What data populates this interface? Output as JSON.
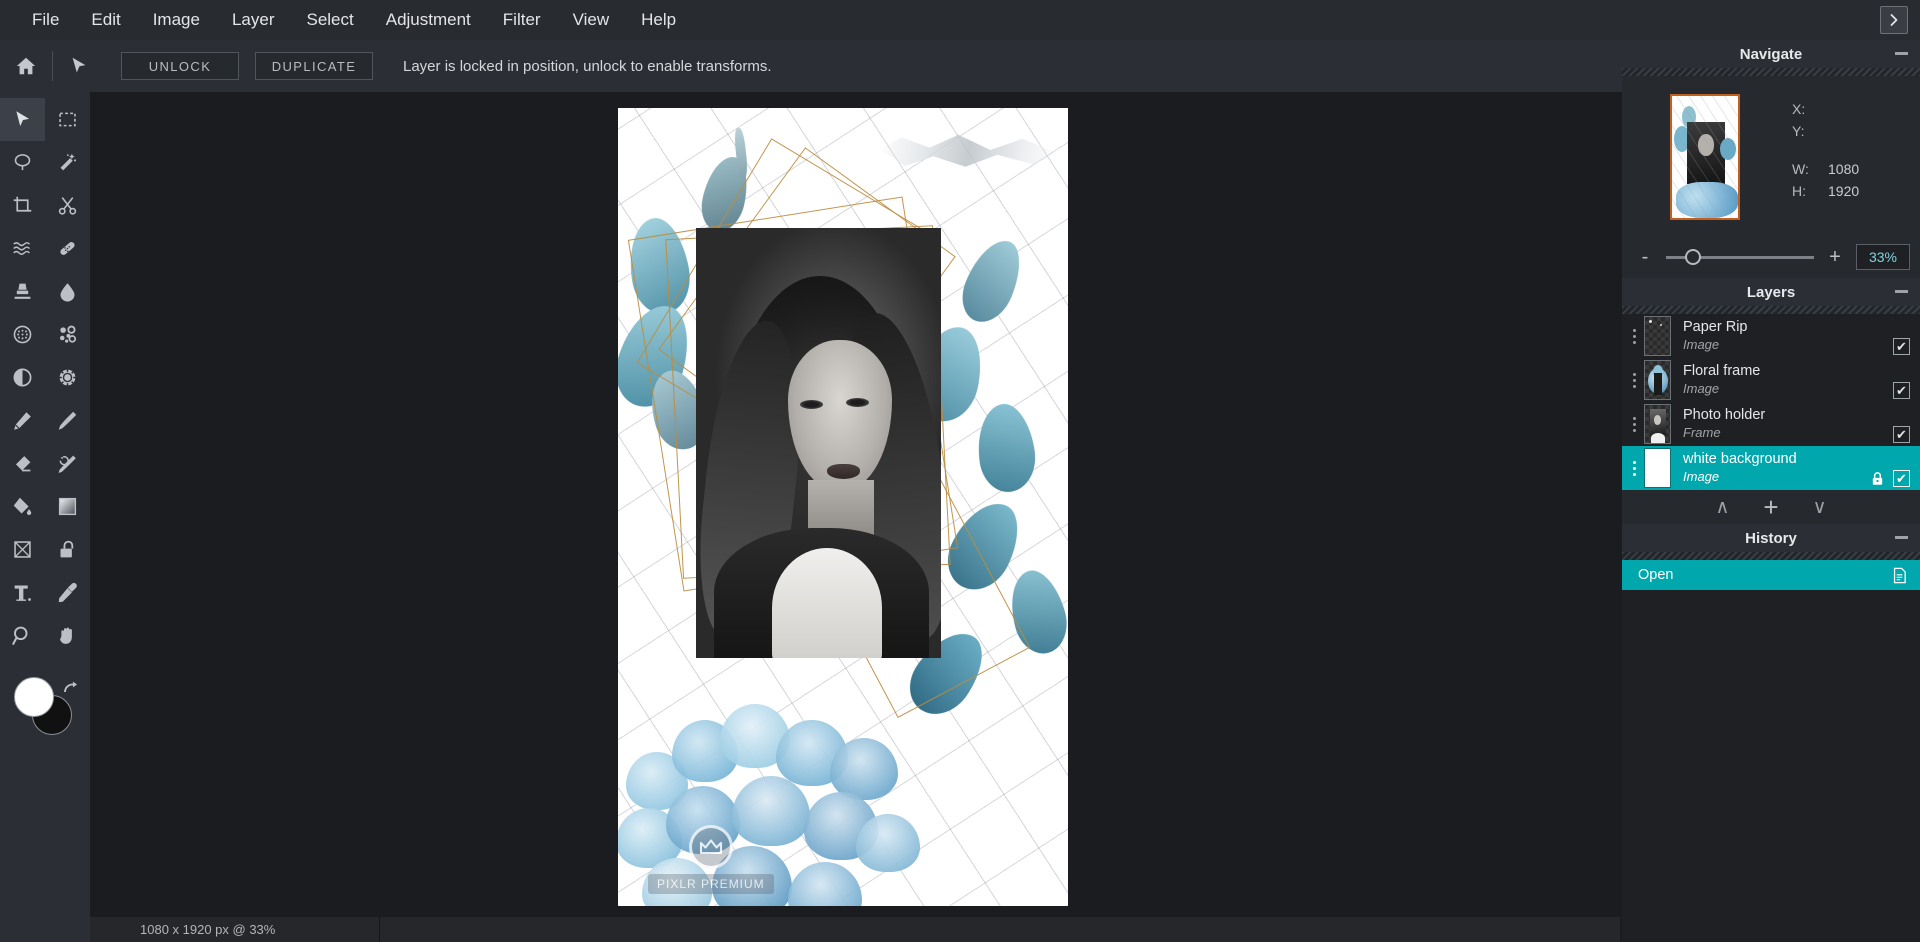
{
  "menubar": {
    "items": [
      {
        "label": "File"
      },
      {
        "label": "Edit"
      },
      {
        "label": "Image"
      },
      {
        "label": "Layer"
      },
      {
        "label": "Select"
      },
      {
        "label": "Adjustment"
      },
      {
        "label": "Filter"
      },
      {
        "label": "View"
      },
      {
        "label": "Help"
      }
    ],
    "expand_icon": "chevron-right-icon"
  },
  "optionsbar": {
    "home_icon": "home-icon",
    "active_tool_icon": "arrow-select-icon",
    "unlock_label": "UNLOCK",
    "duplicate_label": "DUPLICATE",
    "hint": "Layer is locked in position, unlock to enable transforms."
  },
  "toolbar": {
    "tools": [
      {
        "name": "arrange-select-tool",
        "icon": "cursor-arrow-icon",
        "active": true
      },
      {
        "name": "marquee-select-tool",
        "icon": "dashed-rectangle-icon",
        "active": false
      },
      {
        "name": "lasso-select-tool",
        "icon": "lasso-icon",
        "active": false
      },
      {
        "name": "magic-wand-tool",
        "icon": "magic-wand-icon",
        "active": false
      },
      {
        "name": "crop-tool",
        "icon": "crop-icon",
        "active": false
      },
      {
        "name": "cutout-tool",
        "icon": "scissors-icon",
        "active": false
      },
      {
        "name": "liquify-tool",
        "icon": "wave-lines-icon",
        "active": false
      },
      {
        "name": "heal-tool",
        "icon": "bandage-icon",
        "active": false
      },
      {
        "name": "clone-stamp-tool",
        "icon": "stamp-icon",
        "active": false
      },
      {
        "name": "blur-tool",
        "icon": "water-drop-icon",
        "active": false
      },
      {
        "name": "detail-tool",
        "icon": "dotted-circle-icon",
        "active": false
      },
      {
        "name": "dodge-burn-tool",
        "icon": "bubbles-icon",
        "active": false
      },
      {
        "name": "contrast-tool",
        "icon": "half-circle-icon",
        "active": false
      },
      {
        "name": "effects-tool",
        "icon": "sun-gear-icon",
        "active": false
      },
      {
        "name": "pen-tool",
        "icon": "pen-icon",
        "active": false
      },
      {
        "name": "paint-brush-tool",
        "icon": "paint-brush-icon",
        "active": false
      },
      {
        "name": "eraser-tool",
        "icon": "eraser-icon",
        "active": false
      },
      {
        "name": "retouch-brush-tool",
        "icon": "brush-swirl-icon",
        "active": false
      },
      {
        "name": "paint-bucket-tool",
        "icon": "paint-bucket-icon",
        "active": false
      },
      {
        "name": "gradient-tool",
        "icon": "gradient-square-icon",
        "active": false
      },
      {
        "name": "shape-tool",
        "icon": "crossed-box-icon",
        "active": false
      },
      {
        "name": "lock-shape-tool",
        "icon": "padlock-icon",
        "active": false
      },
      {
        "name": "text-tool",
        "icon": "text-t-icon",
        "active": false
      },
      {
        "name": "color-picker-tool",
        "icon": "eyedropper-icon",
        "active": false
      },
      {
        "name": "zoom-tool",
        "icon": "magnifier-icon",
        "active": false
      },
      {
        "name": "hand-tool",
        "icon": "hand-icon",
        "active": false
      }
    ],
    "foreground_color": "#ffffff",
    "background_color": "#111111",
    "swap_icon": "swap-colors-icon"
  },
  "canvas": {
    "watermark_text": "PIXLR PREMIUM",
    "watermark_icon": "crown-icon"
  },
  "statusbar": {
    "zoom_info": "1080 x 1920 px @ 33%"
  },
  "navigate": {
    "title": "Navigate",
    "minimize_icon": "minimize-icon",
    "thumbnail_name": "navigate-thumbnail",
    "fields": [
      {
        "label": "X:",
        "value": ""
      },
      {
        "label": "Y:",
        "value": ""
      },
      {
        "label": "W:",
        "value": "1080"
      },
      {
        "label": "H:",
        "value": "1920"
      }
    ],
    "zoom_minus": "-",
    "zoom_plus": "+",
    "zoom_value": "33%",
    "zoom_slider_percent": 13
  },
  "layers": {
    "title": "Layers",
    "minimize_icon": "minimize-icon",
    "items": [
      {
        "name": "Paper Rip",
        "kind": "Image",
        "visible": true,
        "locked": false,
        "selected": false,
        "thumb": "transparent"
      },
      {
        "name": "Floral frame",
        "kind": "Image",
        "visible": true,
        "locked": false,
        "selected": false,
        "thumb": "floral"
      },
      {
        "name": "Photo holder",
        "kind": "Frame",
        "visible": true,
        "locked": false,
        "selected": false,
        "thumb": "photo"
      },
      {
        "name": "white background",
        "kind": "Image",
        "visible": true,
        "locked": true,
        "selected": true,
        "thumb": "white"
      }
    ],
    "actions": [
      {
        "name": "move-layer-up-button",
        "icon": "chevron-up-icon",
        "glyph": "∧"
      },
      {
        "name": "add-layer-button",
        "icon": "plus-icon",
        "glyph": "+"
      },
      {
        "name": "move-layer-down-button",
        "icon": "chevron-down-icon",
        "glyph": "∨"
      }
    ],
    "check_glyph": "✔",
    "lock_icon": "padlock-icon"
  },
  "history": {
    "title": "History",
    "minimize_icon": "minimize-icon",
    "items": [
      {
        "label": "Open",
        "icon": "document-icon",
        "selected": true
      }
    ]
  },
  "colors": {
    "accent": "#00a8ad",
    "panel_bg": "#1e2024",
    "chrome_bg": "#2b2f35",
    "menu_bg": "#282b30",
    "workspace_bg": "#1b1c1f",
    "thumb_border": "#c4601f",
    "zoom_text": "#7fd4e0"
  }
}
